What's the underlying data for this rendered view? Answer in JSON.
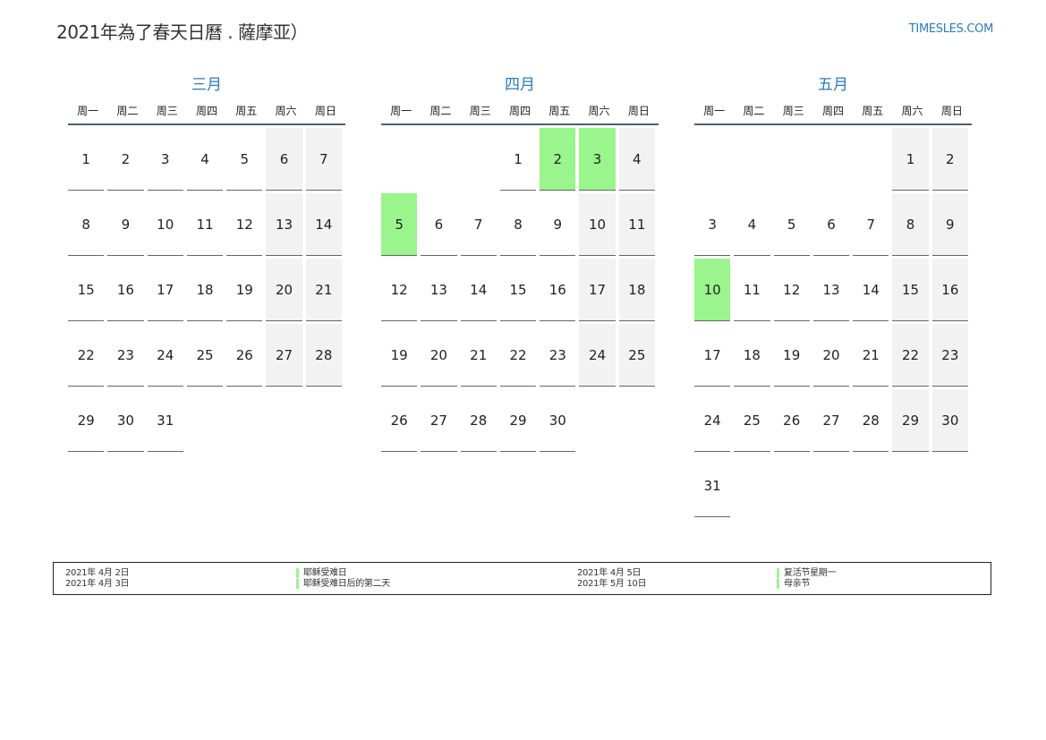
{
  "header": {
    "title": "2021年為了春天日曆 . 薩摩亚）",
    "site": "TIMESLES.COM"
  },
  "weekdays": [
    "周一",
    "周二",
    "周三",
    "周四",
    "周五",
    "周六",
    "周日"
  ],
  "colors": {
    "accent": "#2a7bbf",
    "holiday": "#99f58c",
    "weekend": "#f2f2f2"
  },
  "months": [
    {
      "name": "三月",
      "weeks": [
        [
          "1",
          "2",
          "3",
          "4",
          "5",
          "6",
          "7"
        ],
        [
          "8",
          "9",
          "10",
          "11",
          "12",
          "13",
          "14"
        ],
        [
          "15",
          "16",
          "17",
          "18",
          "19",
          "20",
          "21"
        ],
        [
          "22",
          "23",
          "24",
          "25",
          "26",
          "27",
          "28"
        ],
        [
          "29",
          "30",
          "31",
          "",
          "",
          "",
          ""
        ]
      ],
      "holidays": []
    },
    {
      "name": "四月",
      "weeks": [
        [
          "",
          "",
          "",
          "1",
          "2",
          "3",
          "4"
        ],
        [
          "5",
          "6",
          "7",
          "8",
          "9",
          "10",
          "11"
        ],
        [
          "12",
          "13",
          "14",
          "15",
          "16",
          "17",
          "18"
        ],
        [
          "19",
          "20",
          "21",
          "22",
          "23",
          "24",
          "25"
        ],
        [
          "26",
          "27",
          "28",
          "29",
          "30",
          "",
          ""
        ]
      ],
      "holidays": [
        "2",
        "3",
        "5"
      ]
    },
    {
      "name": "五月",
      "weeks": [
        [
          "",
          "",
          "",
          "",
          "",
          "1",
          "2"
        ],
        [
          "3",
          "4",
          "5",
          "6",
          "7",
          "8",
          "9"
        ],
        [
          "10",
          "11",
          "12",
          "13",
          "14",
          "15",
          "16"
        ],
        [
          "17",
          "18",
          "19",
          "20",
          "21",
          "22",
          "23"
        ],
        [
          "24",
          "25",
          "26",
          "27",
          "28",
          "29",
          "30"
        ],
        [
          "31",
          "",
          "",
          "",
          "",
          "",
          ""
        ]
      ],
      "holidays": [
        "10"
      ]
    }
  ],
  "legend": {
    "col1": [
      {
        "date": "2021年 4月 2日",
        "name": "耶稣受难日"
      },
      {
        "date": "2021年 4月 3日",
        "name": "耶稣受难日后的第二天"
      }
    ],
    "col2": [
      {
        "date": "2021年 4月 5日",
        "name": "复活节星期一"
      },
      {
        "date": "2021年 5月 10日",
        "name": "母亲节"
      }
    ]
  }
}
